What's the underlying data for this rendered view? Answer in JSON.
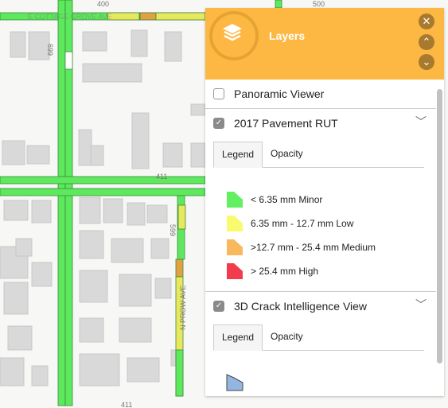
{
  "map": {
    "labels": {
      "block_400": "400",
      "block_500": "500",
      "street_699": "699",
      "block_411": "411",
      "street_599": "599",
      "street_n_prow": "N PROW AVE",
      "street_cottage": "E COTTAGE GROVE AVE",
      "bottom_411": "411"
    },
    "rut_colors": {
      "minor": "#5de85d",
      "low": "#f0ef6a",
      "medium": "#e79a3e",
      "high": "#f1404f"
    }
  },
  "panel": {
    "title": "Layers",
    "icon": "layers-icon",
    "accent_color": "#fdb843",
    "buttons": {
      "close": "✕",
      "up": "⌃",
      "down": "⌄"
    },
    "layers": [
      {
        "label": "Panoramic Viewer",
        "checked": false
      },
      {
        "label": "2017 Pavement RUT",
        "checked": true,
        "tabs": [
          "Legend",
          "Opacity"
        ],
        "active_tab": "Legend",
        "legend": [
          {
            "label": "< 6.35 mm Minor",
            "color": "#62f062"
          },
          {
            "label": "6.35 mm - 12.7 mm Low",
            "color": "#fafa6e"
          },
          {
            "label": ">12.7 mm - 25.4 mm Medium",
            "color": "#f9b75e"
          },
          {
            "label": "> 25.4 mm High",
            "color": "#f23c4d"
          }
        ]
      },
      {
        "label": "3D Crack Intelligence View",
        "checked": true,
        "tabs": [
          "Legend",
          "Opacity"
        ],
        "active_tab": "Legend",
        "legend": [
          {
            "label": "",
            "color": "#93b6e0"
          }
        ]
      }
    ]
  }
}
